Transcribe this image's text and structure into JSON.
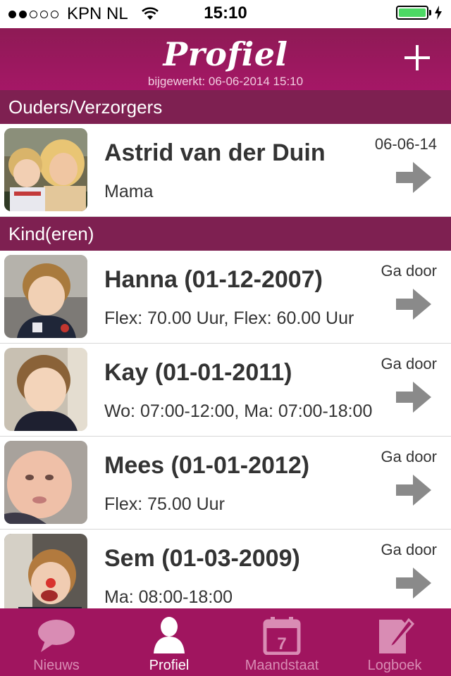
{
  "status_bar": {
    "carrier": "KPN NL",
    "time": "15:10",
    "signal_strength": 2,
    "battery_level": 1.0,
    "battery_color": "#4cd964"
  },
  "header": {
    "title": "Profiel",
    "subtitle": "bijgewerkt: 06-06-2014 15:10",
    "add_icon": "plus-icon"
  },
  "sections": {
    "parents_title": "Ouders/Verzorgers",
    "children_title": "Kind(eren)"
  },
  "parents": [
    {
      "name": "Astrid van der Duin",
      "subtitle": "Mama",
      "meta": "06-06-14",
      "action_icon": "arrow-right-icon"
    }
  ],
  "children": [
    {
      "name": "Hanna (01-12-2007)",
      "subtitle": "Flex: 70.00 Uur, Flex: 60.00 Uur",
      "meta": "Ga door",
      "action_icon": "arrow-right-icon"
    },
    {
      "name": "Kay (01-01-2011)",
      "subtitle": "Wo: 07:00-12:00, Ma: 07:00-18:00",
      "meta": "Ga door",
      "action_icon": "arrow-right-icon"
    },
    {
      "name": "Mees (01-01-2012)",
      "subtitle": "Flex: 75.00 Uur",
      "meta": "Ga door",
      "action_icon": "arrow-right-icon"
    },
    {
      "name": "Sem (01-03-2009)",
      "subtitle": "Ma: 08:00-18:00",
      "meta": "Ga door",
      "action_icon": "arrow-right-icon"
    }
  ],
  "tabbar": {
    "tabs": [
      {
        "label": "Nieuws",
        "icon": "speech-bubble-icon",
        "active": false
      },
      {
        "label": "Profiel",
        "icon": "person-icon",
        "active": true
      },
      {
        "label": "Maandstaat",
        "icon": "calendar-icon",
        "active": false,
        "icon_text": "7"
      },
      {
        "label": "Logboek",
        "icon": "notebook-pencil-icon",
        "active": false
      }
    ]
  },
  "colors": {
    "header": "#a51766",
    "section_header": "#7e2051",
    "tabbar": "#a0155f",
    "tab_inactive": "#d98cb4",
    "arrow": "#8a8a8a"
  }
}
